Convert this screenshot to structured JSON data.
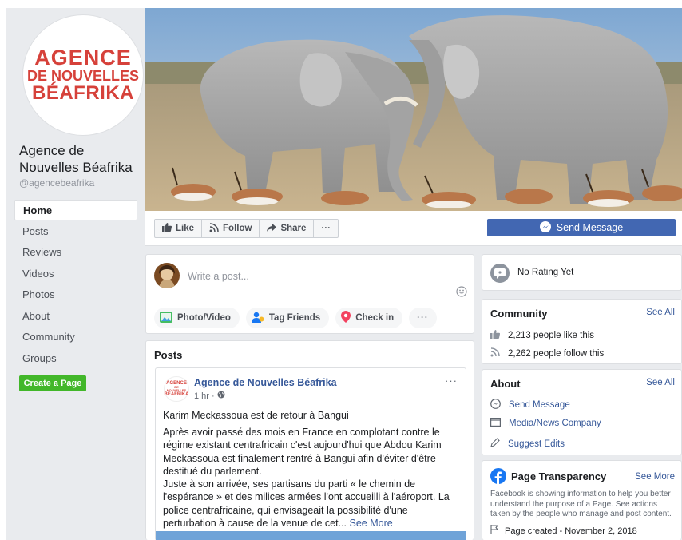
{
  "logo": {
    "line1": "AGENCE",
    "line2": "DE NOUVELLES",
    "line3": "BÉAFRIKA"
  },
  "page": {
    "name": "Agence de Nouvelles Béafrika",
    "handle": "@agencebeafrika"
  },
  "nav": {
    "items": [
      "Home",
      "Posts",
      "Reviews",
      "Videos",
      "Photos",
      "About",
      "Community",
      "Groups"
    ],
    "active": "Home",
    "create_page": "Create a Page"
  },
  "actions": {
    "like": "Like",
    "follow": "Follow",
    "share": "Share",
    "more": "···",
    "send_message": "Send Message"
  },
  "composer": {
    "placeholder": "Write a post...",
    "actions": [
      "Photo/Video",
      "Tag Friends",
      "Check in"
    ],
    "more": "···"
  },
  "posts": {
    "title": "Posts",
    "post": {
      "author": "Agence de Nouvelles Béafrika",
      "time": "1 hr ·",
      "more": "···",
      "headline": "Karim Meckassoua est de retour à Bangui",
      "body": "Après avoir passé des mois en France en complotant contre le régime existant centrafricain c'est aujourd'hui que Abdou Karim Meckassoua est finalement rentré à Bangui afin d'éviter d'être destitué du parlement.\nJuste à son arrivée, ses partisans du parti « le chemin de l'espérance » et des milices armées l'ont accueilli à l'aéroport. La police centrafricaine, qui envisageait la possibilité d'une perturbation à cause de la venue de cet...",
      "see_more": "See More",
      "avatar_logo": [
        "AGENCE",
        "DE NOUVELLES",
        "BÉAFRIKA"
      ]
    }
  },
  "rating": {
    "text": "No Rating Yet"
  },
  "community": {
    "title": "Community",
    "see_all": "See All",
    "likes": "2,213 people like this",
    "follows": "2,262 people follow this"
  },
  "about": {
    "title": "About",
    "see_all": "See All",
    "send_message": "Send Message",
    "category": "Media/News Company",
    "suggest": "Suggest Edits"
  },
  "transparency": {
    "title": "Page Transparency",
    "see_more": "See More",
    "text": "Facebook is showing information to help you better understand the purpose of a Page. See actions taken by the people who manage and post content.",
    "created": "Page created - November 2, 2018"
  },
  "colors": {
    "accent": "#4267b2",
    "link": "#365899",
    "logo_red": "#d6413a",
    "create_green": "#42b72a",
    "background": "#e9ebee"
  }
}
